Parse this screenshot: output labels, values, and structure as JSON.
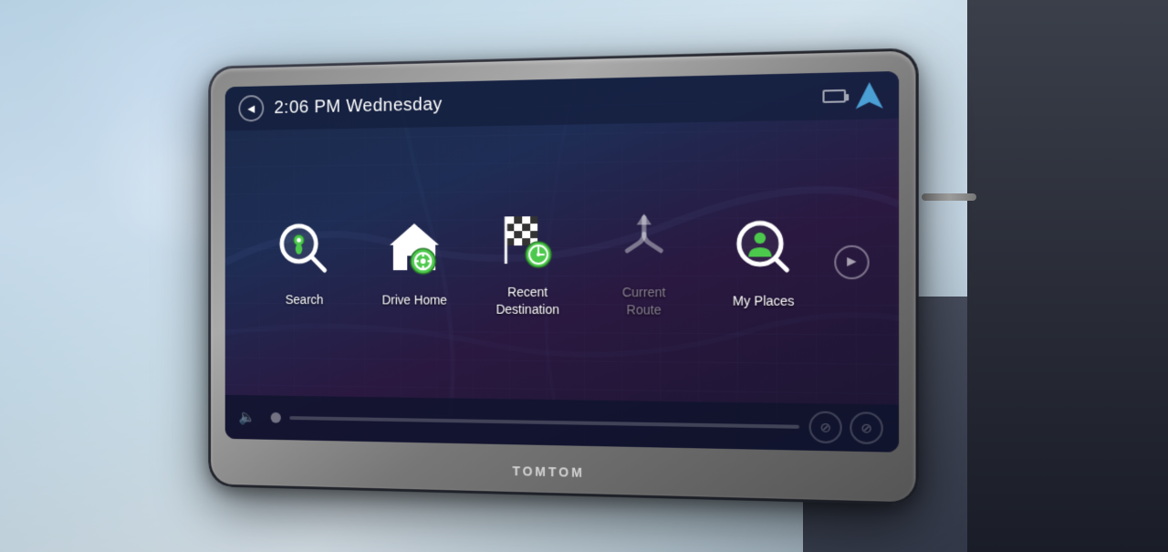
{
  "background": {
    "description": "Car interior with GPS device on windshield"
  },
  "device": {
    "brand": "TOMTOM"
  },
  "header": {
    "back_label": "◄",
    "time": "2:06 PM Wednesday",
    "next_label": "►"
  },
  "menu": {
    "items": [
      {
        "id": "search",
        "label": "Search",
        "icon": "search"
      },
      {
        "id": "drive-home",
        "label": "Drive Home",
        "icon": "home"
      },
      {
        "id": "recent-destination",
        "label": "Recent\nDestination",
        "label_line1": "Recent",
        "label_line2": "Destination",
        "icon": "recent"
      },
      {
        "id": "current-route",
        "label": "Current\nRoute",
        "label_line1": "Current",
        "label_line2": "Route",
        "icon": "route",
        "dimmed": true
      },
      {
        "id": "my-places",
        "label": "My Places",
        "icon": "places"
      }
    ]
  },
  "bottom": {
    "volume_icon": "🔈",
    "no_sound_label": "⊘",
    "settings_label": "⊘"
  }
}
